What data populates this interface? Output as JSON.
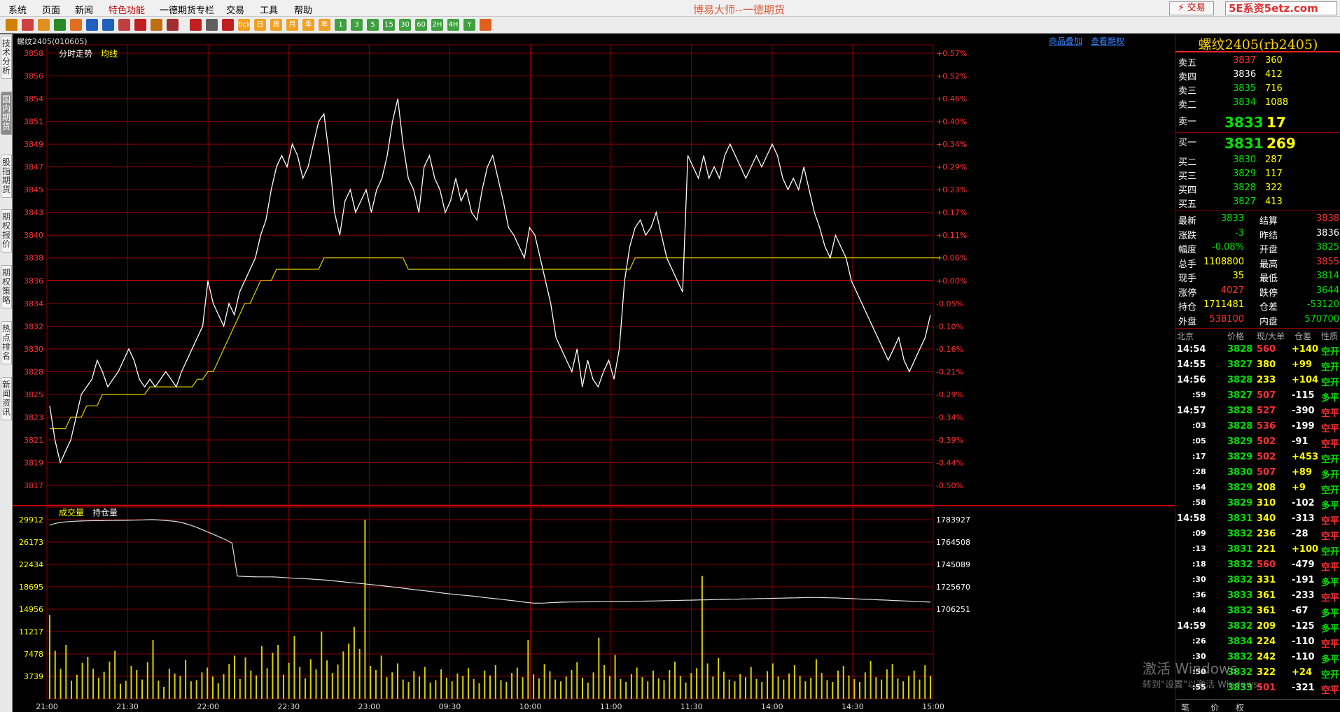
{
  "menu": [
    "系统",
    "页面",
    "新闻",
    "特色功能",
    "一德期货专栏",
    "交易",
    "工具",
    "帮助"
  ],
  "app_title": "博易大师--一德期货",
  "trade_button": "⚡ 交易",
  "site_button": "5E系资5etz.com",
  "toolbar_icons": [
    "back-icon",
    "home-icon",
    "book-icon",
    "refresh-icon",
    "bar-icon",
    "zoom-in-icon",
    "zoom-out-icon",
    "window-icon",
    "pen-icon",
    "flag-icon",
    "filter-icon",
    "indicator-icon",
    "list-icon",
    "trend-icon",
    "minute-icon",
    "day-icon",
    "week-icon",
    "month-icon",
    "season-icon",
    "year-icon",
    "1m-icon",
    "3m-icon",
    "5m-icon",
    "15m-icon",
    "30m-icon",
    "60m-icon",
    "2h-icon",
    "4h-icon",
    "yr-icon",
    "calc-icon"
  ],
  "toolbar_labels": [
    "",
    "",
    "",
    "",
    "",
    "",
    "",
    "",
    "",
    "",
    "",
    "",
    "",
    "",
    "tick",
    "日",
    "周",
    "月",
    "季",
    "年",
    "1",
    "3",
    "5",
    "15",
    "30",
    "60",
    "2H",
    "4H",
    "Y",
    ""
  ],
  "side_tabs": [
    "技术分析",
    "国内期货",
    "股指期货",
    "期权报价",
    "期权策略",
    "热点排名",
    "新闻资讯"
  ],
  "instrument_label": "螺纹2405(010605)",
  "top_links": [
    "商品叠加",
    "查看期权"
  ],
  "price_pane": {
    "title": "分时走势",
    "avg_label": "均线",
    "y_ticks": [
      "3858",
      "3856",
      "3854",
      "3851",
      "3849",
      "3847",
      "3845",
      "3843",
      "3840",
      "3838",
      "3836",
      "3834",
      "3832",
      "3830",
      "3828",
      "3825",
      "3823",
      "3821",
      "3819",
      "3817"
    ],
    "pct_ticks": [
      "+0.57%",
      "+0.52%",
      "+0.46%",
      "+0.40%",
      "+0.34%",
      "+0.29%",
      "+0.23%",
      "+0.17%",
      "+0.11%",
      "+0.06%",
      "+0.00%",
      "-0.05%",
      "-0.10%",
      "-0.16%",
      "-0.21%",
      "-0.29%",
      "-0.34%",
      "-0.39%",
      "-0.44%",
      "-0.50%"
    ]
  },
  "volume_pane": {
    "title": "成交量",
    "oi_label": "持仓量",
    "y_ticks": [
      "29912",
      "26173",
      "22434",
      "18695",
      "14956",
      "11217",
      "7478",
      "3739"
    ],
    "oi_ticks": [
      "1783927",
      "1764508",
      "1745089",
      "1725670",
      "1706251"
    ]
  },
  "x_ticks": [
    "21:00",
    "21:30",
    "22:00",
    "22:30",
    "23:00",
    "09:30",
    "10:00",
    "11:00",
    "11:30",
    "14:00",
    "14:30",
    "15:00"
  ],
  "chart_data": {
    "type": "line",
    "title": "分时走势",
    "preclose": 3836,
    "x_categories": [
      "21:00",
      "21:30",
      "22:00",
      "22:30",
      "23:00",
      "09:30",
      "10:00",
      "11:00",
      "11:30",
      "14:00",
      "14:30",
      "15:00"
    ],
    "ylim": [
      3817,
      3858
    ],
    "price": [
      3824,
      3821,
      3819,
      3820,
      3821,
      3823,
      3825,
      3826,
      3827,
      3829,
      3828,
      3826,
      3827,
      3828,
      3829,
      3830,
      3829,
      3827,
      3826,
      3827,
      3826,
      3827,
      3828,
      3827,
      3826,
      3828,
      3829,
      3830,
      3831,
      3832,
      3836,
      3834,
      3833,
      3832,
      3834,
      3833,
      3835,
      3836,
      3837,
      3838,
      3840,
      3842,
      3845,
      3847,
      3848,
      3847,
      3849,
      3848,
      3846,
      3847,
      3849,
      3851,
      3852,
      3848,
      3843,
      3840,
      3844,
      3845,
      3843,
      3844,
      3845,
      3843,
      3845,
      3846,
      3848,
      3851,
      3854,
      3849,
      3846,
      3845,
      3843,
      3847,
      3848,
      3846,
      3845,
      3843,
      3844,
      3846,
      3844,
      3845,
      3843,
      3842,
      3845,
      3847,
      3848,
      3846,
      3844,
      3841,
      3840,
      3839,
      3838,
      3841,
      3840,
      3838,
      3836,
      3834,
      3831,
      3830,
      3829,
      3828,
      3830,
      3826,
      3829,
      3827,
      3826,
      3828,
      3829,
      3827,
      3830,
      3836,
      3839,
      3841,
      3842,
      3840,
      3841,
      3843,
      3840,
      3838,
      3837,
      3836,
      3835,
      3848,
      3847,
      3846,
      3848,
      3846,
      3847,
      3846,
      3848,
      3849,
      3848,
      3847,
      3846,
      3847,
      3848,
      3847,
      3848,
      3849,
      3848,
      3846,
      3845,
      3846,
      3845,
      3847,
      3845,
      3843,
      3841,
      3839,
      3838,
      3840,
      3839,
      3838,
      3836,
      3835,
      3834,
      3833,
      3832,
      3831,
      3830,
      3829,
      3830,
      3831,
      3829,
      3828,
      3829,
      3830,
      3831,
      3833
    ],
    "avg": [
      3822,
      3822,
      3822,
      3822,
      3823,
      3823,
      3823,
      3824,
      3824,
      3824,
      3825,
      3825,
      3825,
      3825,
      3825,
      3825,
      3825,
      3825,
      3825,
      3826,
      3826,
      3826,
      3826,
      3826,
      3826,
      3826,
      3826,
      3826,
      3827,
      3827,
      3828,
      3828,
      3829,
      3830,
      3831,
      3832,
      3833,
      3834,
      3834,
      3835,
      3836,
      3836,
      3836,
      3837,
      3837,
      3837,
      3837,
      3837,
      3837,
      3837,
      3837,
      3837,
      3838,
      3838,
      3838,
      3838,
      3838,
      3838,
      3838,
      3838,
      3838,
      3838,
      3838,
      3838,
      3838,
      3838,
      3838,
      3838,
      3837,
      3837,
      3837,
      3837,
      3837,
      3837,
      3837,
      3837,
      3837,
      3837,
      3837,
      3837,
      3837,
      3837,
      3837,
      3837,
      3837,
      3837,
      3837,
      3837,
      3837,
      3837,
      3837,
      3837,
      3837,
      3837,
      3837,
      3837,
      3837,
      3837,
      3837,
      3837,
      3837,
      3837,
      3837,
      3837,
      3837,
      3837,
      3837,
      3837,
      3837,
      3837,
      3837,
      3838,
      3838,
      3838,
      3838,
      3838,
      3838,
      3838,
      3838,
      3838,
      3838,
      3838,
      3838,
      3838,
      3838,
      3838,
      3838,
      3838,
      3838,
      3838,
      3838,
      3838,
      3838,
      3838,
      3838,
      3838,
      3838,
      3838,
      3838,
      3838,
      3838,
      3838,
      3838,
      3838,
      3838,
      3838,
      3838,
      3838,
      3838,
      3838,
      3838,
      3838,
      3838,
      3838,
      3838,
      3838,
      3838,
      3838,
      3838,
      3838,
      3838,
      3838,
      3838,
      3838,
      3838,
      3838,
      3838,
      3838,
      3838,
      3838
    ],
    "open_interest": [
      1779000,
      1780500,
      1781500,
      1782000,
      1782300,
      1782600,
      1782800,
      1782900,
      1783000,
      1783100,
      1783100,
      1783200,
      1783200,
      1783300,
      1783300,
      1783400,
      1783500,
      1783600,
      1783700,
      1783900,
      1783927,
      1783600,
      1783300,
      1782900,
      1782500,
      1781800,
      1780600,
      1779200,
      1777600,
      1775800,
      1773900,
      1772000,
      1770000,
      1768000,
      1766000,
      1763500,
      1735000,
      1734700,
      1734500,
      1734400,
      1734300,
      1734300,
      1734300,
      1734200,
      1734000,
      1733700,
      1733400,
      1733100,
      1733000,
      1732700,
      1732400,
      1732100,
      1731800,
      1731500,
      1731100,
      1730600,
      1730200,
      1729600,
      1729200,
      1728800,
      1728400,
      1727900,
      1727400,
      1727000,
      1726500,
      1726000,
      1725500,
      1725000,
      1724400,
      1723800,
      1723200,
      1722700,
      1722200,
      1721700,
      1721100,
      1720500,
      1719900,
      1719400,
      1719000,
      1718500,
      1718100,
      1717700,
      1717200,
      1716600,
      1716100,
      1715600,
      1715100,
      1714600,
      1714100,
      1713600,
      1713000,
      1712400,
      1711900,
      1711500,
      1711481,
      1711600,
      1711900,
      1712100,
      1712300,
      1712400,
      1712500,
      1712500,
      1712600,
      1712600,
      1712700,
      1712700,
      1712800,
      1712800,
      1712900,
      1712900,
      1713000,
      1713000,
      1713100,
      1713100,
      1713200,
      1713300,
      1713400,
      1713500,
      1713600,
      1713700,
      1713800,
      1713900,
      1714000,
      1714100,
      1714200,
      1714300,
      1714400,
      1714500,
      1714600,
      1714700,
      1714800,
      1714900,
      1715000,
      1715100,
      1715200,
      1715300,
      1715400,
      1715500,
      1715600,
      1715700,
      1715800,
      1715900,
      1716000,
      1716100,
      1716200,
      1716300,
      1716400,
      1716400,
      1716300,
      1716200,
      1716100,
      1716000,
      1715800,
      1715600,
      1715400,
      1715200,
      1715000,
      1714800,
      1714600,
      1714400,
      1714200,
      1714000,
      1713800,
      1713600,
      1713400,
      1713200,
      1713000,
      1712800,
      1712600,
      1712400
    ],
    "volume": [
      14000,
      8000,
      5000,
      9000,
      3000,
      4000,
      6000,
      7000,
      5000,
      3500,
      4500,
      6200,
      8000,
      2500,
      3000,
      5500,
      4800,
      3200,
      6100,
      9800,
      3000,
      2000,
      5000,
      4200,
      3800,
      6500,
      2900,
      3100,
      4400,
      5200,
      3700,
      2600,
      4100,
      5800,
      7200,
      3300,
      6900,
      4700,
      3900,
      8800,
      5100,
      7700,
      9000,
      4000,
      6000,
      10500,
      5300,
      3400,
      6600,
      4900,
      11200,
      6400,
      4300,
      5700,
      7900,
      9200,
      12000,
      8300,
      29912,
      5500,
      4800,
      7200,
      3600,
      4400,
      5900,
      3200,
      2800,
      4600,
      3700,
      5300,
      2700,
      3100,
      4900,
      3500,
      2900,
      4200,
      3800,
      5100,
      3300,
      2600,
      4700,
      3900,
      5600,
      3100,
      2800,
      4300,
      5200,
      3600,
      9800,
      4100,
      3400,
      5800,
      4600,
      3200,
      2900,
      3700,
      4800,
      6100,
      3500,
      2700,
      4400,
      10200,
      5600,
      3800,
      7300,
      3300,
      2800,
      4100,
      5200,
      3600,
      2900,
      4700,
      3400,
      3100,
      4800,
      6200,
      3800,
      2700,
      4300,
      5100,
      20500,
      5900,
      3700,
      6800,
      4500,
      3200,
      2900,
      4100,
      3600,
      5300,
      3300,
      2800,
      4600,
      5900,
      3700,
      3200,
      4200,
      5600,
      3800,
      2900,
      3500,
      6600,
      4300,
      3100,
      2800,
      4700,
      5500,
      3900,
      3300,
      2800,
      4400,
      6300,
      3600,
      3200,
      4900,
      5800,
      3400,
      2900,
      3800,
      4700,
      3200,
      5600,
      3800
    ]
  },
  "quote": {
    "title": "螺纹2405(rb2405)",
    "asks": [
      {
        "label": "卖五",
        "price": "3837",
        "vol": "360"
      },
      {
        "label": "卖四",
        "price": "3836",
        "vol": "412"
      },
      {
        "label": "卖三",
        "price": "3835",
        "vol": "716"
      },
      {
        "label": "卖二",
        "price": "3834",
        "vol": "1088"
      },
      {
        "label": "卖一",
        "price": "3833",
        "vol": "17"
      }
    ],
    "bids": [
      {
        "label": "买一",
        "price": "3831",
        "vol": "269"
      },
      {
        "label": "买二",
        "price": "3830",
        "vol": "287"
      },
      {
        "label": "买三",
        "price": "3829",
        "vol": "117"
      },
      {
        "label": "买四",
        "price": "3828",
        "vol": "322"
      },
      {
        "label": "买五",
        "price": "3827",
        "vol": "413"
      }
    ],
    "stats": [
      {
        "l1": "最新",
        "v1": "3833",
        "l2": "结算",
        "v2": "3838"
      },
      {
        "l1": "涨跌",
        "v1": "-3",
        "l2": "昨结",
        "v2": "3836"
      },
      {
        "l1": "幅度",
        "v1": "-0.08%",
        "l2": "开盘",
        "v2": "3825"
      },
      {
        "l1": "总手",
        "v1": "1108800",
        "l2": "最高",
        "v2": "3855"
      },
      {
        "l1": "现手",
        "v1": "35",
        "l2": "最低",
        "v2": "3814"
      },
      {
        "l1": "涨停",
        "v1": "4027",
        "l2": "跌停",
        "v2": "3644"
      },
      {
        "l1": "持仓",
        "v1": "1711481",
        "l2": "仓差",
        "v2": "-53120"
      },
      {
        "l1": "外盘",
        "v1": "538100",
        "l2": "内盘",
        "v2": "570700"
      }
    ]
  },
  "ticks_header": [
    "北京",
    "价格",
    "现/大单",
    "仓差",
    "性质"
  ],
  "ticks": [
    {
      "time": "14:54",
      "price": "3828",
      "vol": "560",
      "oi": "+140",
      "nature": "空开"
    },
    {
      "time": "14:55",
      "price": "3827",
      "vol": "380",
      "oi": "+99",
      "nature": "空开"
    },
    {
      "time": "14:56",
      "price": "3828",
      "vol": "233",
      "oi": "+104",
      "nature": "空开"
    },
    {
      "time": ":59",
      "price": "3827",
      "vol": "507",
      "oi": "-115",
      "nature": "多平"
    },
    {
      "time": "14:57",
      "price": "3828",
      "vol": "527",
      "oi": "-390",
      "nature": "空平"
    },
    {
      "time": ":03",
      "price": "3828",
      "vol": "536",
      "oi": "-199",
      "nature": "空平"
    },
    {
      "time": ":05",
      "price": "3829",
      "vol": "502",
      "oi": "-91",
      "nature": "空平"
    },
    {
      "time": ":17",
      "price": "3829",
      "vol": "502",
      "oi": "+453",
      "nature": "空开"
    },
    {
      "time": ":28",
      "price": "3830",
      "vol": "507",
      "oi": "+89",
      "nature": "多开"
    },
    {
      "time": ":54",
      "price": "3829",
      "vol": "208",
      "oi": "+9",
      "nature": "空开"
    },
    {
      "time": ":58",
      "price": "3829",
      "vol": "310",
      "oi": "-102",
      "nature": "多平"
    },
    {
      "time": "14:58",
      "price": "3831",
      "vol": "340",
      "oi": "-313",
      "nature": "空平"
    },
    {
      "time": ":09",
      "price": "3832",
      "vol": "236",
      "oi": "-28",
      "nature": "空平"
    },
    {
      "time": ":13",
      "price": "3831",
      "vol": "221",
      "oi": "+100",
      "nature": "空开"
    },
    {
      "time": ":18",
      "price": "3832",
      "vol": "560",
      "oi": "-479",
      "nature": "空平"
    },
    {
      "time": ":30",
      "price": "3832",
      "vol": "331",
      "oi": "-191",
      "nature": "多平"
    },
    {
      "time": ":36",
      "price": "3833",
      "vol": "361",
      "oi": "-233",
      "nature": "空平"
    },
    {
      "time": ":44",
      "price": "3832",
      "vol": "361",
      "oi": "-67",
      "nature": "多平"
    },
    {
      "time": "14:59",
      "price": "3832",
      "vol": "209",
      "oi": "-125",
      "nature": "多平"
    },
    {
      "time": ":26",
      "price": "3834",
      "vol": "224",
      "oi": "-110",
      "nature": "空平"
    },
    {
      "time": ":30",
      "price": "3832",
      "vol": "242",
      "oi": "-110",
      "nature": "多平"
    },
    {
      "time": ":50",
      "price": "3832",
      "vol": "322",
      "oi": "+24",
      "nature": "空开"
    },
    {
      "time": ":55",
      "price": "3833",
      "vol": "501",
      "oi": "-321",
      "nature": "空平"
    }
  ],
  "bottom_tabs": [
    "笔",
    "价",
    "权"
  ],
  "watermark": [
    "激活 Windows",
    "转到\"设置\"以激活 Windows。"
  ],
  "colors": {
    "up": "#ff3030",
    "down": "#00e000",
    "neutral": "#ffffff",
    "grid": "#8a0000",
    "price_line": "#ffffff",
    "avg_line": "#e0d000",
    "volume_bar": "#d8d000",
    "axis_label_price": "#ff3030",
    "yellow": "#ffff00"
  }
}
